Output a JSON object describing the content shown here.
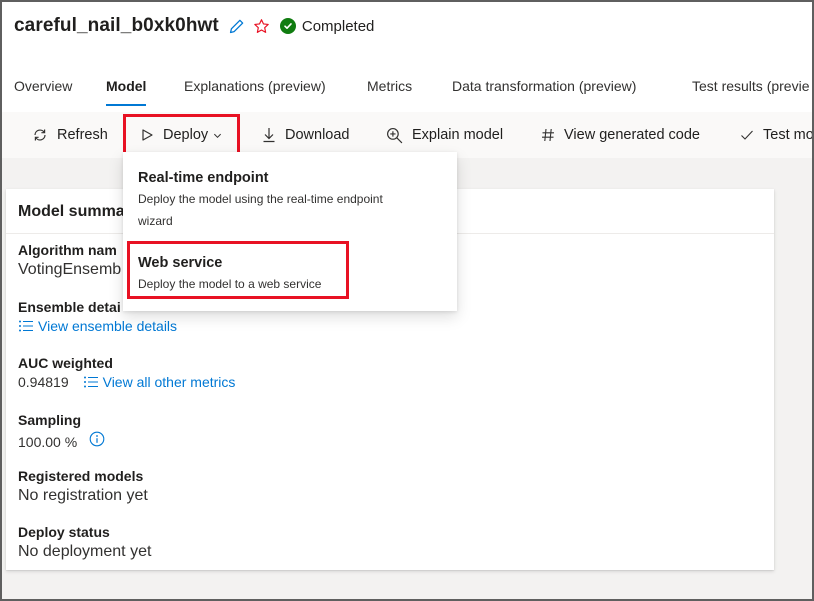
{
  "header": {
    "run_name": "careful_nail_b0xk0hwt",
    "status": "Completed",
    "colors": {
      "status_green": "#107c10",
      "accent": "#0078d4",
      "highlight": "#e81123"
    }
  },
  "tabs": [
    {
      "label": "Overview"
    },
    {
      "label": "Model"
    },
    {
      "label": "Explanations (preview)"
    },
    {
      "label": "Metrics"
    },
    {
      "label": "Data transformation (preview)"
    },
    {
      "label": "Test results (previe"
    }
  ],
  "toolbar": {
    "refresh": "Refresh",
    "deploy": "Deploy",
    "download": "Download",
    "explain": "Explain model",
    "view_code": "View generated code",
    "test": "Test mo"
  },
  "deploy_menu": {
    "items": [
      {
        "title": "Real-time endpoint",
        "desc1": "Deploy the model using the real-time endpoint",
        "desc2": "wizard"
      },
      {
        "title": "Web service",
        "desc1": "Deploy the model to a web service"
      }
    ]
  },
  "summary": {
    "title": "Model summa",
    "algorithm_label": "Algorithm nam",
    "algorithm_value": "VotingEnsemb",
    "ensemble_label": "Ensemble detai",
    "ensemble_link": "View ensemble details",
    "auc_label": "AUC weighted",
    "auc_value": "0.94819",
    "auc_link": "View all other metrics",
    "sampling_label": "Sampling",
    "sampling_value": "100.00 %",
    "registered_label": "Registered models",
    "registered_value": "No registration yet",
    "deploy_status_label": "Deploy status",
    "deploy_status_value": "No deployment yet"
  }
}
